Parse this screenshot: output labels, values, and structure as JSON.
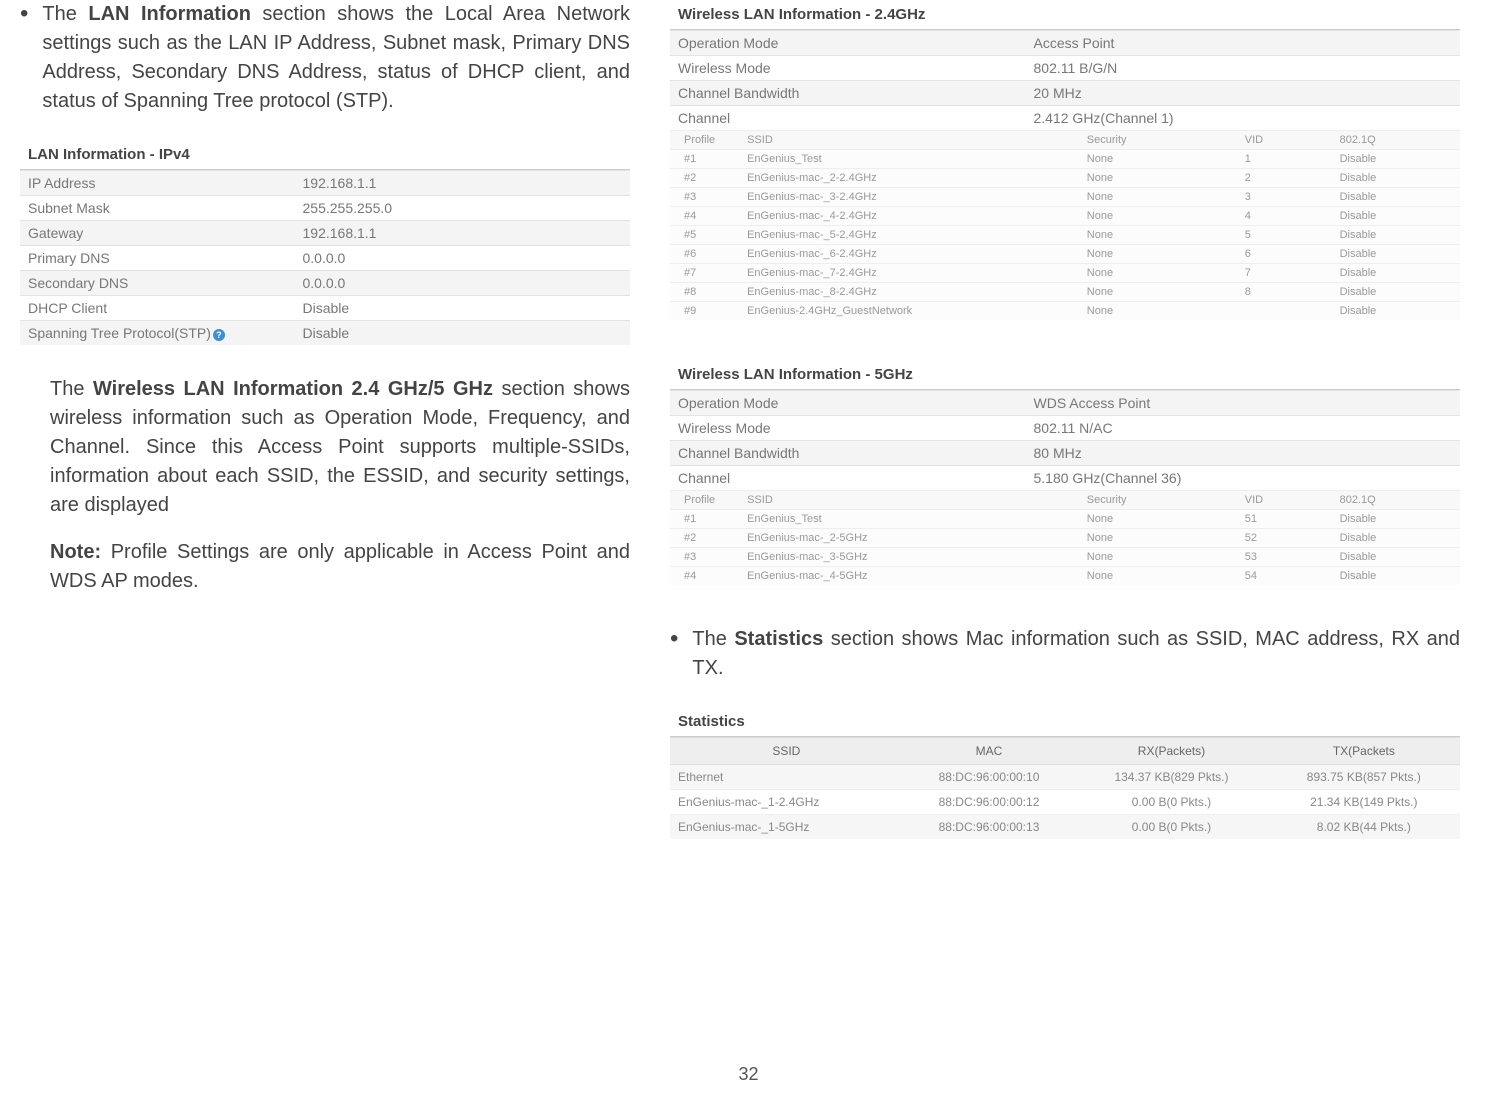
{
  "left": {
    "bullet1_pre": "The ",
    "bullet1_bold": "LAN Information",
    "bullet1_post": " section shows the Local Area Network settings such as the LAN IP Address, Subnet mask, Primary DNS Address, Secondary DNS Address, status of DHCP client, and status of Spanning Tree protocol (STP).",
    "lan_title": "LAN Information - IPv4",
    "lan_rows": [
      {
        "k": "IP Address",
        "v": "192.168.1.1"
      },
      {
        "k": "Subnet Mask",
        "v": "255.255.255.0"
      },
      {
        "k": "Gateway",
        "v": "192.168.1.1"
      },
      {
        "k": "Primary DNS",
        "v": "0.0.0.0"
      },
      {
        "k": "Secondary DNS",
        "v": "0.0.0.0"
      },
      {
        "k": "DHCP Client",
        "v": "Disable"
      },
      {
        "k": "Spanning Tree Protocol(STP)",
        "v": "Disable",
        "help": true
      }
    ],
    "para2_pre": "The ",
    "para2_bold": "Wireless LAN Information 2.4 GHz/5 GHz",
    "para2_post": " section shows wireless information such as Operation Mode, Frequency, and Channel. Since this Access Point supports multiple-SSIDs, information about each SSID, the ESSID, and security settings, are displayed",
    "note_bold": "Note:",
    "note_text": " Profile Settings are only applicable in Access Point and WDS AP modes."
  },
  "right": {
    "wlan24": {
      "title": "Wireless LAN Information - 2.4GHz",
      "rows": [
        {
          "k": "Operation Mode",
          "v": "Access Point"
        },
        {
          "k": "Wireless Mode",
          "v": "802.11 B/G/N"
        },
        {
          "k": "Channel Bandwidth",
          "v": "20 MHz"
        },
        {
          "k": "Channel",
          "v": "2.412 GHz(Channel 1)"
        }
      ],
      "headers": {
        "profile": "Profile",
        "ssid": "SSID",
        "security": "Security",
        "vid": "VID",
        "q": "802.1Q"
      },
      "profiles": [
        {
          "p": "#1",
          "s": "EnGenius_Test",
          "sec": "None",
          "vid": "1",
          "q": "Disable"
        },
        {
          "p": "#2",
          "s": "EnGenius-mac-_2-2.4GHz",
          "sec": "None",
          "vid": "2",
          "q": "Disable"
        },
        {
          "p": "#3",
          "s": "EnGenius-mac-_3-2.4GHz",
          "sec": "None",
          "vid": "3",
          "q": "Disable"
        },
        {
          "p": "#4",
          "s": "EnGenius-mac-_4-2.4GHz",
          "sec": "None",
          "vid": "4",
          "q": "Disable"
        },
        {
          "p": "#5",
          "s": "EnGenius-mac-_5-2.4GHz",
          "sec": "None",
          "vid": "5",
          "q": "Disable"
        },
        {
          "p": "#6",
          "s": "EnGenius-mac-_6-2.4GHz",
          "sec": "None",
          "vid": "6",
          "q": "Disable"
        },
        {
          "p": "#7",
          "s": "EnGenius-mac-_7-2.4GHz",
          "sec": "None",
          "vid": "7",
          "q": "Disable"
        },
        {
          "p": "#8",
          "s": "EnGenius-mac-_8-2.4GHz",
          "sec": "None",
          "vid": "8",
          "q": "Disable"
        },
        {
          "p": "#9",
          "s": "EnGenius-2.4GHz_GuestNetwork",
          "sec": "None",
          "vid": "",
          "q": "Disable"
        }
      ]
    },
    "wlan5": {
      "title": "Wireless LAN Information - 5GHz",
      "rows": [
        {
          "k": "Operation Mode",
          "v": "WDS Access Point"
        },
        {
          "k": "Wireless Mode",
          "v": "802.11 N/AC"
        },
        {
          "k": "Channel Bandwidth",
          "v": "80 MHz"
        },
        {
          "k": "Channel",
          "v": "5.180 GHz(Channel 36)"
        }
      ],
      "headers": {
        "profile": "Profile",
        "ssid": "SSID",
        "security": "Security",
        "vid": "VID",
        "q": "802.1Q"
      },
      "profiles": [
        {
          "p": "#1",
          "s": "EnGenius_Test",
          "sec": "None",
          "vid": "51",
          "q": "Disable"
        },
        {
          "p": "#2",
          "s": "EnGenius-mac-_2-5GHz",
          "sec": "None",
          "vid": "52",
          "q": "Disable"
        },
        {
          "p": "#3",
          "s": "EnGenius-mac-_3-5GHz",
          "sec": "None",
          "vid": "53",
          "q": "Disable"
        },
        {
          "p": "#4",
          "s": "EnGenius-mac-_4-5GHz",
          "sec": "None",
          "vid": "54",
          "q": "Disable"
        }
      ]
    },
    "stats_para_pre": "The ",
    "stats_para_bold": "Statistics",
    "stats_para_post": " section shows Mac information such as SSID, MAC address, RX and TX.",
    "stats_title": "Statistics",
    "stats_headers": {
      "ssid": "SSID",
      "mac": "MAC",
      "rx": "RX(Packets)",
      "tx": "TX(Packets"
    },
    "stats_rows": [
      {
        "ssid": "Ethernet",
        "mac": "88:DC:96:00:00:10",
        "rx": "134.37 KB(829 Pkts.)",
        "tx": "893.75 KB(857 Pkts.)"
      },
      {
        "ssid": "EnGenius-mac-_1-2.4GHz",
        "mac": "88:DC:96:00:00:12",
        "rx": "0.00 B(0 Pkts.)",
        "tx": "21.34 KB(149 Pkts.)"
      },
      {
        "ssid": "EnGenius-mac-_1-5GHz",
        "mac": "88:DC:96:00:00:13",
        "rx": "0.00 B(0 Pkts.)",
        "tx": "8.02 KB(44 Pkts.)"
      }
    ]
  },
  "page_number": "32"
}
